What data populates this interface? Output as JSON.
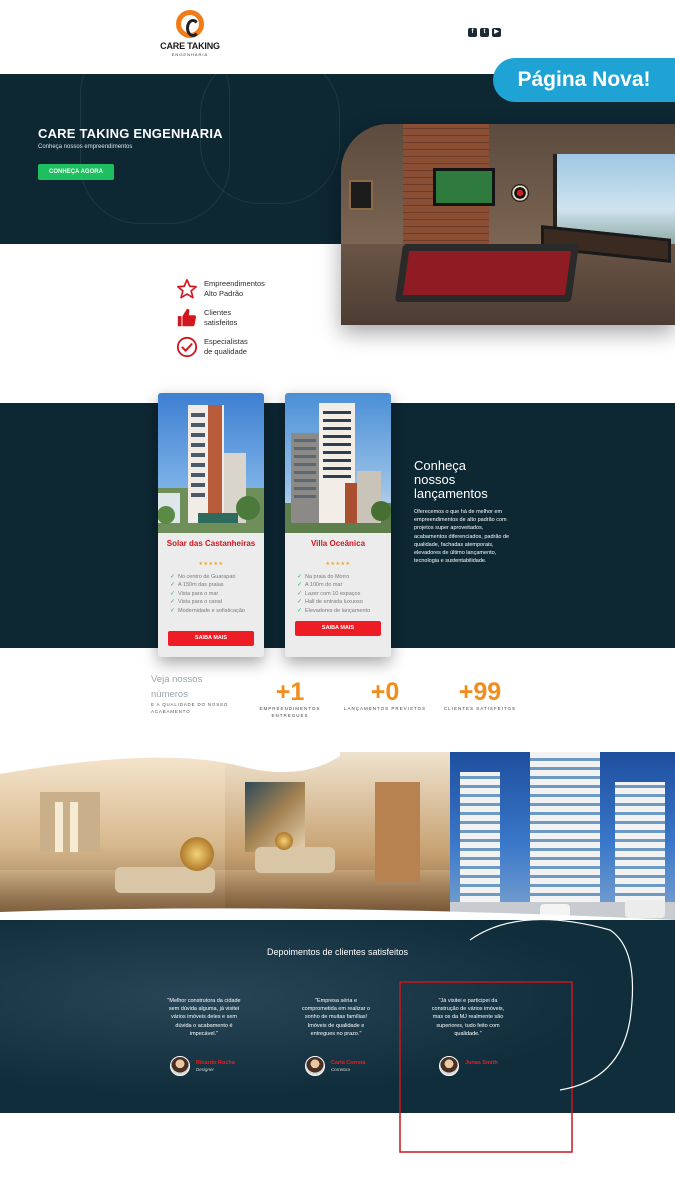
{
  "header": {
    "brand_name": "CARE TAKING",
    "brand_sub": "ENGENHARIA",
    "socials": [
      {
        "icon": "facebook-icon",
        "glyph": "f"
      },
      {
        "icon": "twitter-icon",
        "glyph": "t"
      },
      {
        "icon": "youtube-icon",
        "glyph": "▶"
      }
    ]
  },
  "badge": {
    "label": "Página Nova!"
  },
  "hero": {
    "title": "CARE TAKING ENGENHARIA",
    "subtitle": "Conheça nossos empreendimentos",
    "cta_label": "CONHEÇA AGORA"
  },
  "features": [
    {
      "icon": "star-icon",
      "label": "Empreendimentos\nAlto Padrão"
    },
    {
      "icon": "thumbs-up-icon",
      "label": "Clientes\nsatisfeitos"
    },
    {
      "icon": "check-circle-icon",
      "label": "Especialistas\nde qualidade"
    }
  ],
  "launches": {
    "title": "Conheça\nnossos\nlançamentos",
    "description": "Oferecemos o que há de melhor em empreendimentos de alto padrão com projetos super aproveitados, acabamentos diferenciados, padrão de qualidade, fachadas atemporais, elevadores de último lançamento, tecnologia e sustentabilidade.",
    "cards": [
      {
        "title": "Solar das Castanheiras",
        "stars": "★★★★★",
        "items": [
          "No centro de Guarapari",
          "A 150m das praias",
          "Vista para o mar",
          "Vista para o canal",
          "Modernidade e sofisticação"
        ],
        "button": "SAIBA MAIS"
      },
      {
        "title": "Villa Oceânica",
        "stars": "★★★★★",
        "items": [
          "Na praia do Morro",
          "A 100m do mar",
          "Lazer com 10 espaços",
          "Hall de entrada luxuoso",
          "Elevadores de lançamento"
        ],
        "button": "SAIBA MAIS"
      }
    ]
  },
  "numbers": {
    "title": "Veja nossos\nnúmeros",
    "subtitle": "E A QUALIDADE DO NOSSO ACABAMENTO",
    "stats": [
      {
        "value": "+1",
        "label": "EMPREENDIMENTOS ENTREGUES"
      },
      {
        "value": "+0",
        "label": "LANÇAMENTOS PREVISTOS"
      },
      {
        "value": "+99",
        "label": "CLIENTES SATISFEITOS"
      }
    ]
  },
  "testimonials": {
    "title": "Depoimentos de clientes satisfeitos",
    "items": [
      {
        "quote": "\"Melhor construtora da cidade sem dúvida alguma, já visitei vários imóveis deles e sem dúvida o acabamento é impecável.\"",
        "name": "Ricardo Rocha",
        "role": "Designer"
      },
      {
        "quote": "\"Empresa séria e comprometida em realizar o sonho de muitas famílias! Imóveis de qualidade e entregues no prazo.\"",
        "name": "Carla Correia",
        "role": "Corretora"
      },
      {
        "quote": "\"Já visitei e participei da construção de vários imóveis, mas os da MJ realmente são superiores, tudo feito com qualidade.\"",
        "name": "Jonas Smith",
        "role": ""
      }
    ]
  },
  "colors": {
    "navy": "#0d2733",
    "orange": "#f28c1c",
    "red": "#ee1c24",
    "green": "#1dbf5e",
    "badge_blue": "#1fa3d4"
  }
}
